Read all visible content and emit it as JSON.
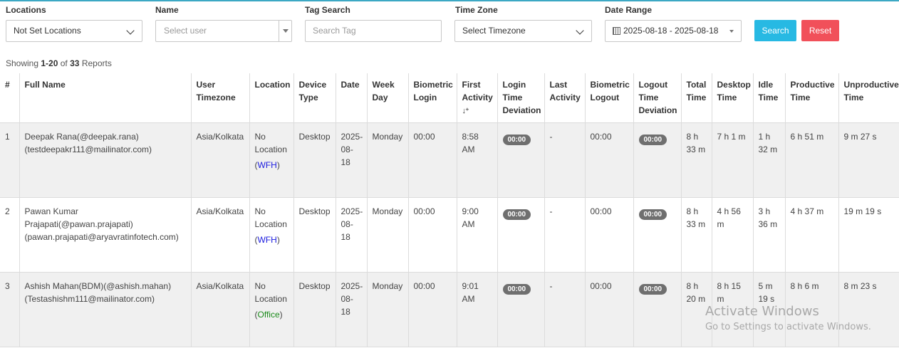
{
  "filters": {
    "locations": {
      "label": "Locations",
      "value": "Not Set Locations"
    },
    "name": {
      "label": "Name",
      "placeholder": "Select user"
    },
    "tag_search": {
      "label": "Tag Search",
      "placeholder": "Search Tag"
    },
    "time_zone": {
      "label": "Time Zone",
      "value": "Select Timezone"
    },
    "date_range": {
      "label": "Date Range",
      "value": "2025-08-18 - 2025-08-18"
    },
    "search_label": "Search",
    "reset_label": "Reset"
  },
  "showing": {
    "prefix": "Showing",
    "range": "1-20",
    "of": "of",
    "total": "33",
    "suffix": "Reports"
  },
  "table": {
    "headers": [
      "#",
      "Full Name",
      "User Timezone",
      "Location",
      "Device Type",
      "Date",
      "Week Day",
      "Biometric Login",
      "First Activity",
      "Login Time Deviation",
      "Last Activity",
      "Biometric Logout",
      "Logout Time Deviation",
      "Total Time",
      "Desktop Time",
      "Idle Time",
      "Productive Time",
      "Unproductive Time"
    ],
    "sort_icon": "sort-descending-icon",
    "rows": [
      {
        "num": "1",
        "name": "Deepak Rana(@deepak.rana)",
        "email": "(testdeepakr111@mailinator.com)",
        "timezone": "Asia/Kolkata",
        "location": "No Location",
        "loc_type": "WFH",
        "device": "Desktop",
        "date": "2025-08-18",
        "weekday": "Monday",
        "bio_login": "00:00",
        "first_activity": "8:58 AM",
        "login_dev": "00:00",
        "last_activity": "-",
        "bio_logout": "00:00",
        "logout_dev": "00:00",
        "total": "8 h 33 m",
        "desktop": "7 h 1 m",
        "idle": "1 h 32 m",
        "productive": "6 h 51 m",
        "unproductive": "9 m 27 s"
      },
      {
        "num": "2",
        "name": "Pawan Kumar Prajapati(@pawan.prajapati)",
        "email": "(pawan.prajapati@aryavratinfotech.com)",
        "timezone": "Asia/Kolkata",
        "location": "No Location",
        "loc_type": "WFH",
        "device": "Desktop",
        "date": "2025-08-18",
        "weekday": "Monday",
        "bio_login": "00:00",
        "first_activity": "9:00 AM",
        "login_dev": "00:00",
        "last_activity": "-",
        "bio_logout": "00:00",
        "logout_dev": "00:00",
        "total": "8 h 33 m",
        "desktop": "4 h 56 m",
        "idle": "3 h 36 m",
        "productive": "4 h 37 m",
        "unproductive": "19 m 19 s"
      },
      {
        "num": "3",
        "name": "Ashish Mahan(BDM)(@ashish.mahan)",
        "email": "(Testashishm111@mailinator.com)",
        "timezone": "Asia/Kolkata",
        "location": "No Location",
        "loc_type": "Office",
        "device": "Desktop",
        "date": "2025-08-18",
        "weekday": "Monday",
        "bio_login": "00:00",
        "first_activity": "9:01 AM",
        "login_dev": "00:00",
        "last_activity": "-",
        "bio_logout": "00:00",
        "logout_dev": "00:00",
        "total": "8 h 20 m",
        "desktop": "8 h 15 m",
        "idle": "5 m 19 s",
        "productive": "8 h 6 m",
        "unproductive": "8 m 23 s"
      }
    ]
  },
  "watermark": {
    "line1": "Activate Windows",
    "line2": "Go to Settings to activate Windows."
  }
}
